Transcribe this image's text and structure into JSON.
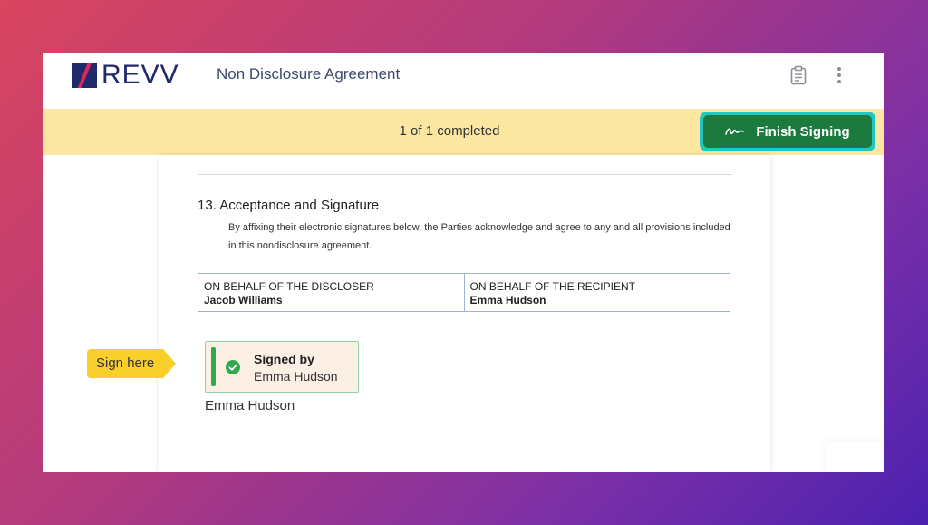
{
  "header": {
    "logo_text": "REVV",
    "document_title": "Non Disclosure Agreement",
    "icons": [
      "clipboard-icon",
      "more-vertical-icon"
    ]
  },
  "banner": {
    "progress_text": "1 of 1 completed",
    "finish_button_label": "Finish Signing"
  },
  "document": {
    "section_title": "13. Acceptance and Signature",
    "section_body": "By affixing their electronic signatures below, the Parties acknowledge and agree to any and all provisions included in this nondisclosure agreement.",
    "parties": [
      {
        "role": "ON BEHALF OF THE DISCLOSER",
        "name": "Jacob Williams"
      },
      {
        "role": "ON BEHALF OF THE RECIPIENT",
        "name": "Emma Hudson"
      }
    ]
  },
  "signature": {
    "flag_label": "Sign here",
    "signed_label": "Signed by",
    "signed_name": "Emma Hudson",
    "signer_name": "Emma Hudson"
  },
  "colors": {
    "brand": "#1f2a6b",
    "banner": "#fbe7a1",
    "finish_button": "#1d7a3f",
    "finish_highlight": "#22c7c1",
    "sign_flag": "#f9cf2b",
    "signed_accent": "#2fa84f"
  }
}
